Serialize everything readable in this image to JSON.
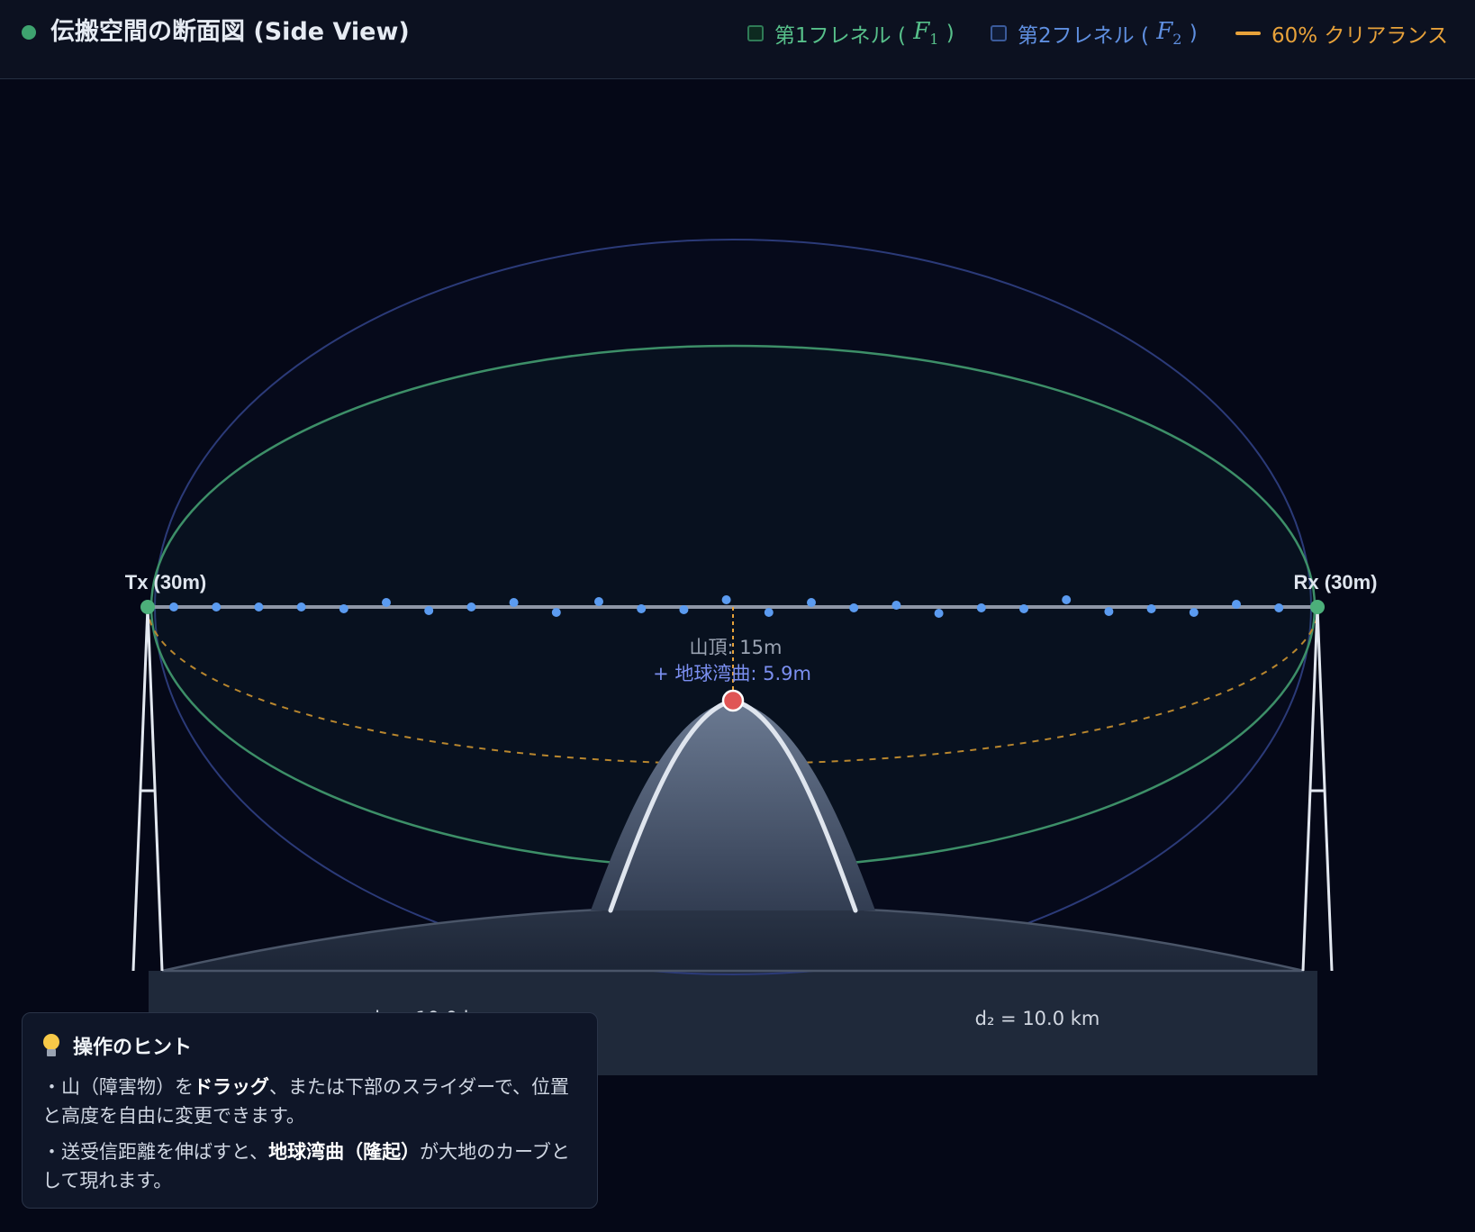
{
  "header": {
    "title": "伝搬空間の断面図 (Side View)",
    "legend": {
      "f1_label": "第1フレネル (",
      "f1_symbol": "F",
      "f1_sub": "1",
      "f1_close": ")",
      "f2_label": "第2フレネル (",
      "f2_symbol": "F",
      "f2_sub": "2",
      "f2_close": ")",
      "clearance_label": "60% クリアランス"
    }
  },
  "diagram": {
    "tx_label": "Tx (30m)",
    "rx_label": "Rx (30m)",
    "peak_label": "山頂: 15m",
    "curvature_label": "+ 地球湾曲: 5.9m",
    "d2_label": "d₂ = 10.0 km",
    "d1_label": "d₁ = 10.0 km"
  },
  "hint": {
    "title": "操作のヒント",
    "line1_a": "・山（障害物）を",
    "line1_b": "ドラッグ",
    "line1_c": "、または下部のスライダーで、位置と高度を自由に変更できます。",
    "line2_a": "・送受信距離を伸ばすと、",
    "line2_b": "地球湾曲（隆起）",
    "line2_c": "が大地のカーブとして現れます。"
  },
  "colors": {
    "background": "#050817",
    "fresnel1": "#3d8f68",
    "fresnel2": "#2b3a78",
    "clearance": "#e8a23a",
    "los": "#8e96a6",
    "particles": "#5b9bf0",
    "endpoint": "#4caf7a",
    "peak_marker": "#e05555"
  }
}
